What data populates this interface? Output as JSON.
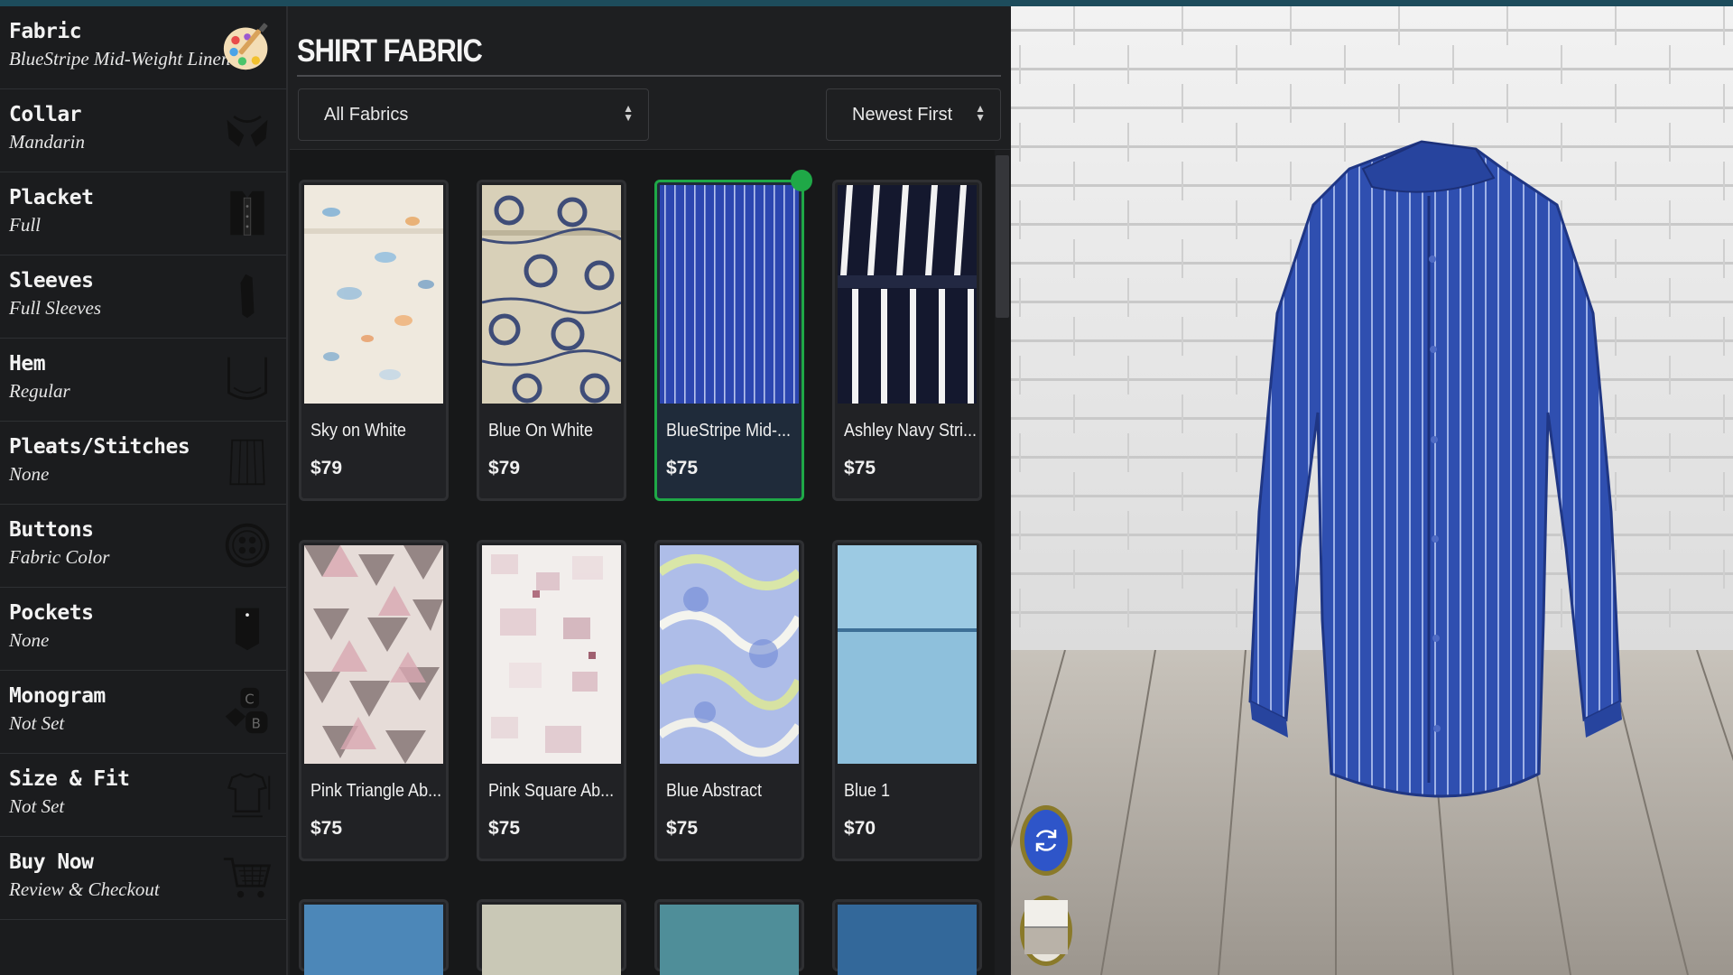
{
  "sidebar": {
    "items": [
      {
        "title": "Fabric",
        "subtitle": "BlueStripe Mid-Weight Linen",
        "icon": "palette-icon"
      },
      {
        "title": "Collar",
        "subtitle": "Mandarin",
        "icon": "collar-icon"
      },
      {
        "title": "Placket",
        "subtitle": "Full",
        "icon": "placket-icon"
      },
      {
        "title": "Sleeves",
        "subtitle": "Full Sleeves",
        "icon": "sleeve-icon"
      },
      {
        "title": "Hem",
        "subtitle": "Regular",
        "icon": "hem-icon"
      },
      {
        "title": "Pleats/Stitches",
        "subtitle": "None",
        "icon": "pleats-icon"
      },
      {
        "title": "Buttons",
        "subtitle": "Fabric Color",
        "icon": "button-icon"
      },
      {
        "title": "Pockets",
        "subtitle": "None",
        "icon": "pocket-icon"
      },
      {
        "title": "Monogram",
        "subtitle": "Not Set",
        "icon": "monogram-icon"
      },
      {
        "title": "Size & Fit",
        "subtitle": "Not Set",
        "icon": "tshirt-measure-icon"
      },
      {
        "title": "Buy Now",
        "subtitle": "Review & Checkout",
        "icon": "cart-icon"
      }
    ]
  },
  "main": {
    "title": "SHIRT FABRIC",
    "filter": {
      "selected": "All Fabrics"
    },
    "sort": {
      "selected": "Newest First"
    },
    "fabrics": [
      {
        "name": "Sky on White",
        "price": "$79",
        "selected": false,
        "swatch": "floral-white"
      },
      {
        "name": "Blue On White",
        "price": "$79",
        "selected": false,
        "swatch": "floral-navy"
      },
      {
        "name": "BlueStripe Mid-...",
        "price": "$75",
        "selected": true,
        "swatch": "stripe-blue"
      },
      {
        "name": "Ashley Navy Stri...",
        "price": "$75",
        "selected": false,
        "swatch": "stripe-navy"
      },
      {
        "name": "Pink Triangle Ab...",
        "price": "$75",
        "selected": false,
        "swatch": "triangle-pink"
      },
      {
        "name": "Pink Square Ab...",
        "price": "$75",
        "selected": false,
        "swatch": "square-pink"
      },
      {
        "name": "Blue Abstract",
        "price": "$75",
        "selected": false,
        "swatch": "abstract-blue"
      },
      {
        "name": "Blue 1",
        "price": "$70",
        "selected": false,
        "swatch": "solid-lightblue"
      }
    ]
  },
  "viewer": {
    "shirt_color": "#2f4fb0",
    "accent": "#1fa847",
    "rotate_icon": "rotate-icon",
    "floor_icon": "floor-toggle-icon"
  }
}
